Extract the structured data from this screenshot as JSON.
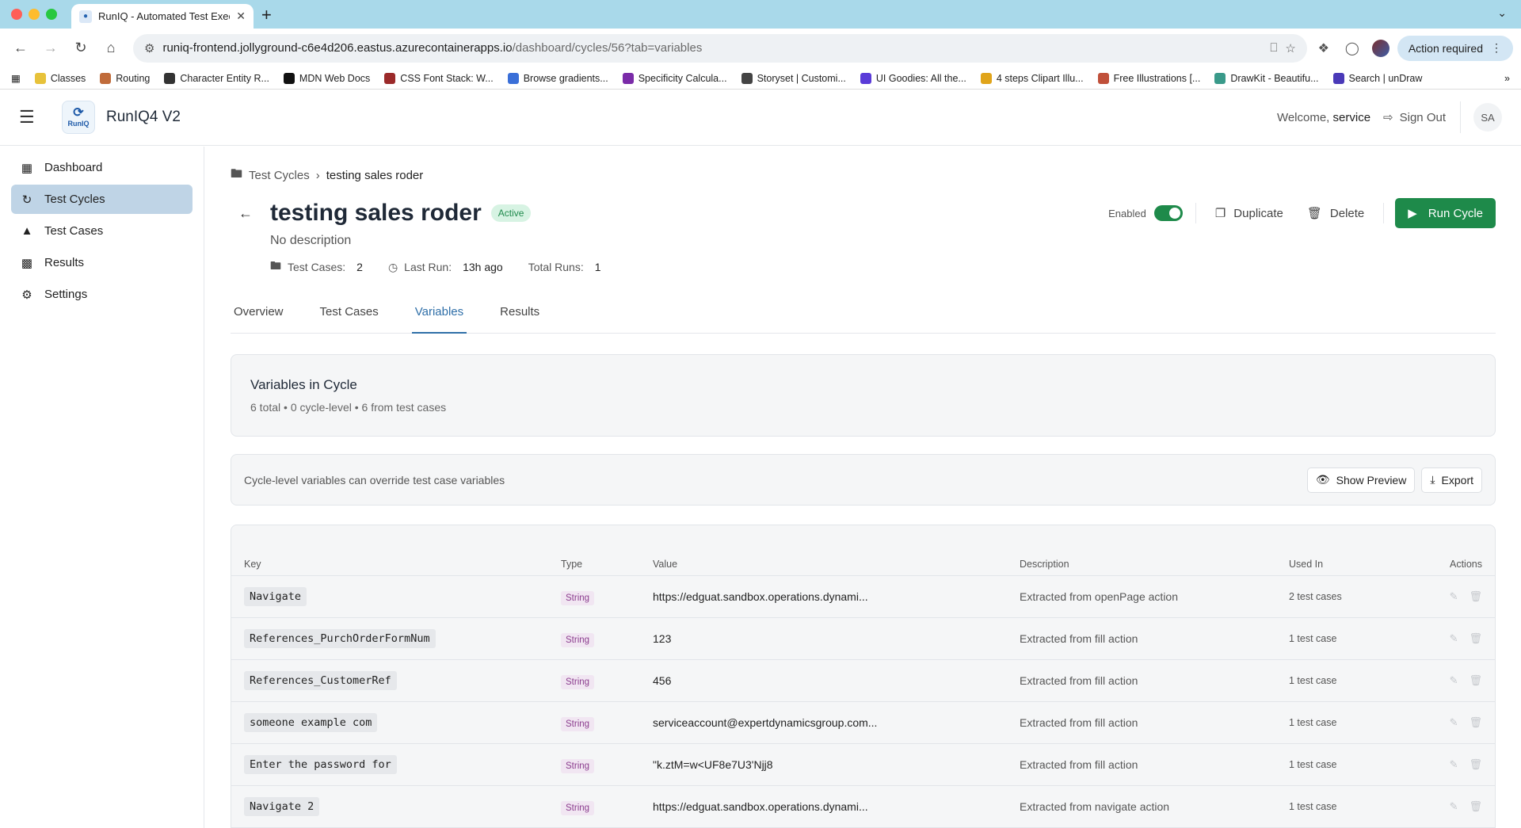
{
  "browser": {
    "tab_title": "RunIQ - Automated Test Exec",
    "url_host": "runiq-frontend.jollyground-c6e4d206.eastus.azurecontainerapps.io",
    "url_path": "/dashboard/cycles/56?tab=variables",
    "action_required": "Action required",
    "bookmarks": [
      {
        "label": "Classes",
        "color": "#e7c23a"
      },
      {
        "label": "Routing",
        "color": "#c06b3a"
      },
      {
        "label": "Character Entity R...",
        "color": "#333333"
      },
      {
        "label": "MDN Web Docs",
        "color": "#111111"
      },
      {
        "label": "CSS Font Stack: W...",
        "color": "#9b2a2a"
      },
      {
        "label": "Browse gradients...",
        "color": "#3a6fd8"
      },
      {
        "label": "Specificity Calcula...",
        "color": "#7a2ba8"
      },
      {
        "label": "Storyset | Customi...",
        "color": "#444444"
      },
      {
        "label": "UI Goodies: All the...",
        "color": "#5a3bd8"
      },
      {
        "label": "4 steps Clipart Illu...",
        "color": "#e0a41a"
      },
      {
        "label": "Free Illustrations [...",
        "color": "#c0503a"
      },
      {
        "label": "DrawKit - Beautifu...",
        "color": "#3a9a8a"
      },
      {
        "label": "Search | unDraw",
        "color": "#4a3ab8"
      }
    ]
  },
  "app": {
    "name": "RunIQ4 V2",
    "logo_text": "RunIQ",
    "welcome_prefix": "Welcome,",
    "username": "service",
    "sign_out": "Sign Out",
    "avatar_initials": "SA"
  },
  "sidebar": {
    "items": [
      {
        "label": "Dashboard",
        "icon": "dashboard-icon"
      },
      {
        "label": "Test Cycles",
        "icon": "cycle-icon"
      },
      {
        "label": "Test Cases",
        "icon": "flask-icon"
      },
      {
        "label": "Results",
        "icon": "bar-chart-icon"
      },
      {
        "label": "Settings",
        "icon": "gear-icon"
      }
    ]
  },
  "page": {
    "breadcrumb_root": "Test Cycles",
    "breadcrumb_current": "testing sales roder",
    "title": "testing sales roder",
    "status": "Active",
    "enabled_label": "Enabled",
    "duplicate": "Duplicate",
    "delete": "Delete",
    "run_cycle": "Run Cycle",
    "description": "No description",
    "meta": {
      "test_cases_label": "Test Cases:",
      "test_cases_value": "2",
      "last_run_label": "Last Run:",
      "last_run_value": "13h ago",
      "total_runs_label": "Total Runs:",
      "total_runs_value": "1"
    },
    "tabs": [
      "Overview",
      "Test Cases",
      "Variables",
      "Results"
    ],
    "active_tab": "Variables"
  },
  "variables": {
    "summary_title": "Variables in Cycle",
    "summary_sub": "6 total • 0 cycle-level • 6 from test cases",
    "hint": "Cycle-level variables can override test case variables",
    "show_preview": "Show Preview",
    "export": "Export",
    "columns": [
      "Key",
      "Type",
      "Value",
      "Description",
      "Used In",
      "Actions"
    ],
    "rows": [
      {
        "key": "Navigate",
        "type": "String",
        "value": "https://edguat.sandbox.operations.dynami...",
        "description": "Extracted from openPage action",
        "used_in": "2 test cases"
      },
      {
        "key": "References_PurchOrderFormNum",
        "type": "String",
        "value": "123",
        "description": "Extracted from fill action",
        "used_in": "1 test case"
      },
      {
        "key": "References_CustomerRef",
        "type": "String",
        "value": "456",
        "description": "Extracted from fill action",
        "used_in": "1 test case"
      },
      {
        "key": "someone example com",
        "type": "String",
        "value": "serviceaccount@expertdynamicsgroup.com...",
        "description": "Extracted from fill action",
        "used_in": "1 test case"
      },
      {
        "key": "Enter the password for",
        "type": "String",
        "value": "\"k.ztM=w<UF8e7U3'Njj8",
        "description": "Extracted from fill action",
        "used_in": "1 test case"
      },
      {
        "key": "Navigate 2",
        "type": "String",
        "value": "https://edguat.sandbox.operations.dynami...",
        "description": "Extracted from navigate action",
        "used_in": "1 test case"
      }
    ]
  }
}
